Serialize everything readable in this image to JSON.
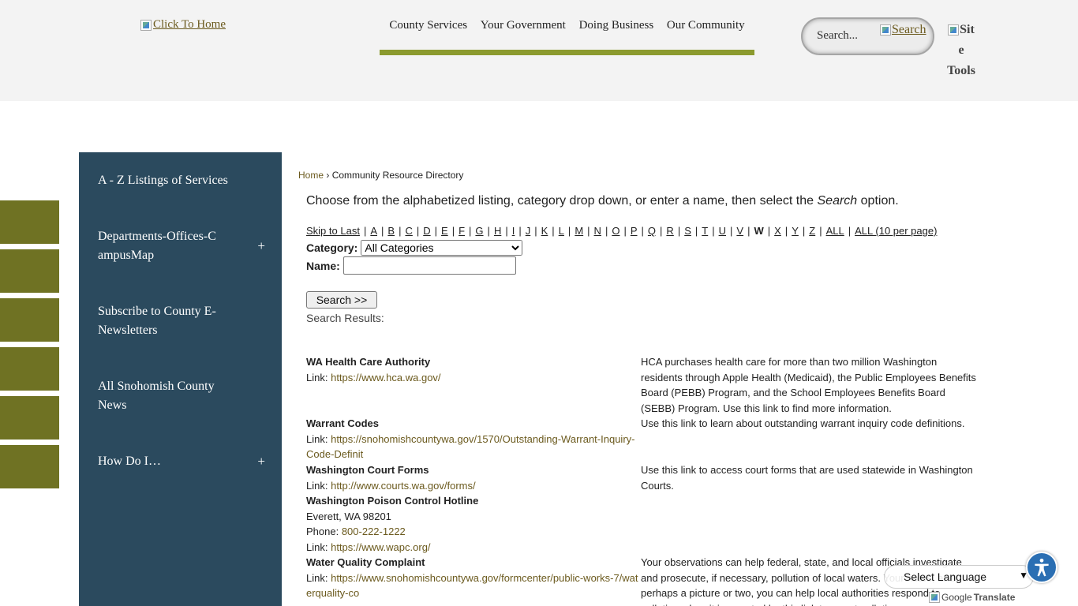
{
  "header": {
    "logo_alt": "Click To Home",
    "nav": [
      "County Services",
      "Your Government",
      "Doing Business",
      "Our Community"
    ],
    "search_placeholder": "Search...",
    "search_button_alt": "Search",
    "site_tools_lines": [
      "Sit",
      "e",
      "Tools"
    ]
  },
  "sidebar": {
    "items": [
      {
        "label": "A - Z Listings of Services",
        "has_plus": false
      },
      {
        "label": "Departments-Offices-CampusMap",
        "has_plus": true
      },
      {
        "label": "Subscribe to County E-Newsletters",
        "has_plus": false
      },
      {
        "label": "All Snohomish County News",
        "has_plus": false
      },
      {
        "label": "How Do I…",
        "has_plus": true
      }
    ],
    "plus_symbol": "+"
  },
  "breadcrumb": {
    "home": "Home",
    "separator": "›",
    "current": "Community Resource Directory"
  },
  "intro": {
    "before": "Choose from the alphabetized listing, category drop down, or enter a name, then select the ",
    "emphasis": "Search",
    "after": " option."
  },
  "alpha_nav": {
    "skip_label": "Skip to Last",
    "letters": [
      "A",
      "B",
      "C",
      "D",
      "E",
      "F",
      "G",
      "H",
      "I",
      "J",
      "K",
      "L",
      "M",
      "N",
      "O",
      "P",
      "Q",
      "R",
      "S",
      "T",
      "U",
      "V",
      "W",
      "X",
      "Y",
      "Z"
    ],
    "current": "W",
    "all_label": "ALL",
    "all_paged_label": "ALL (10 per page)"
  },
  "form": {
    "category_label": "Category:",
    "category_value": "All Categories",
    "name_label": "Name:",
    "name_value": "",
    "search_button": "Search >>",
    "results_label": "Search Results:"
  },
  "results": [
    {
      "title": "WA Health Care Authority",
      "lines": [],
      "link_label": "Link:",
      "link": "https://www.hca.wa.gov/",
      "description": "HCA purchases health care for more than two million Washington residents through Apple Health (Medicaid), the Public Employees Benefits Board (PEBB) Program, and the School Employees Benefits Board (SEBB) Program. Use this link to find more information."
    },
    {
      "title": "Warrant Codes",
      "lines": [],
      "link_label": "Link:",
      "link": "https://snohomishcountywa.gov/1570/Outstanding-Warrant-Inquiry-Code-Definit",
      "description": "Use this link to learn about outstanding warrant inquiry code definitions."
    },
    {
      "title": "Washington Court Forms",
      "lines": [],
      "link_label": "Link:",
      "link": "http://www.courts.wa.gov/forms/",
      "description": "Use this link to access court forms that are used statewide in Washington Courts."
    },
    {
      "title": "Washington Poison Control Hotline",
      "lines": [
        "Everett, WA 98201"
      ],
      "phone_label": "Phone:",
      "phone": "800-222-1222",
      "link_label": "Link:",
      "link": "https://www.wapc.org/",
      "description": ""
    },
    {
      "title": "Water Quality Complaint",
      "lines": [],
      "link_label": "Link:",
      "link": "https://www.snohomishcountywa.gov/formcenter/public-works-7/waterquality-co",
      "description": "Your observations can help federal, state, and local officials investigate and prosecute, if necessary, pollution of local waters. Your notes, and perhaps a picture or two, you can help local authorities respond to pollution when it is reported by this link to report pollution."
    }
  ],
  "widgets": {
    "language_select": "Select Language",
    "google_translate_prefix": "Google",
    "google_translate_suffix": "Translate"
  }
}
